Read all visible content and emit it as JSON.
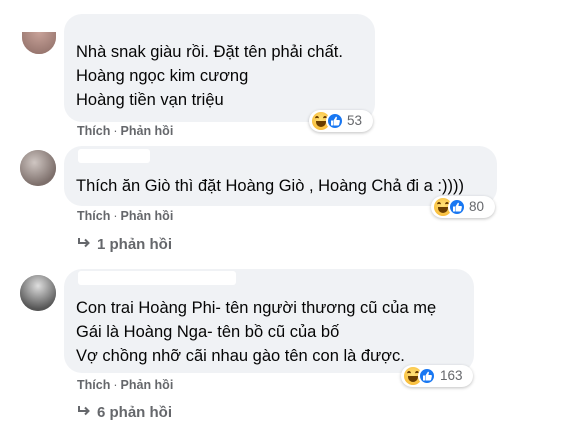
{
  "comments": [
    {
      "lines": "Nhà snak giàu rồi. Đặt tên phải chất.\nHoàng ngọc kim cương\nHoàng tiền vạn triệu",
      "like_label": "Thích",
      "reply_label": "Phản hồi",
      "reaction_count": "53",
      "reaction_icons": [
        "haha-icon",
        "like-icon"
      ]
    },
    {
      "lines": "Thích ăn Giò thì đặt Hoàng Giò , Hoàng Chả đi a :))))",
      "like_label": "Thích",
      "reply_label": "Phản hồi",
      "reaction_count": "80",
      "reaction_icons": [
        "haha-icon",
        "like-icon"
      ],
      "replies_label": "1 phản hồi"
    },
    {
      "lines": "Con trai Hoàng Phi- tên người thương cũ của mẹ\nGái là Hoàng Nga- tên bồ cũ của bố\nVợ chồng nhỡ cãi nhau gào tên con là được.",
      "like_label": "Thích",
      "reply_label": "Phản hồi",
      "reaction_count": "163",
      "reaction_icons": [
        "haha-icon",
        "like-icon"
      ],
      "replies_label": "6 phản hồi"
    }
  ],
  "colors": {
    "bubble": "#f0f2f5",
    "secondary_text": "#65676b",
    "like_blue": "#1877f2",
    "haha_yellow": "#f7b125"
  }
}
